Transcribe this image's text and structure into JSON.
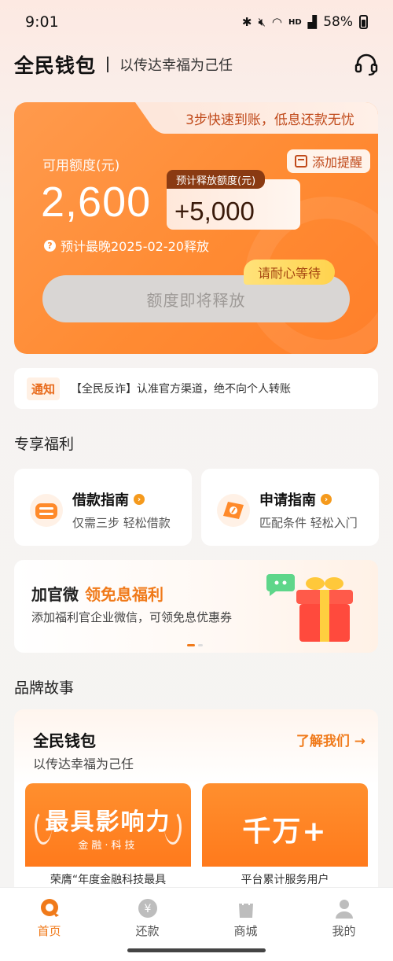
{
  "status_bar": {
    "time": "9:01",
    "network": "HD",
    "battery": "58%"
  },
  "header": {
    "brand": "全民钱包",
    "slogan": "以传达幸福为己任"
  },
  "hero": {
    "tab_text": "3步快速到账，低息还款无忧",
    "available_label": "可用额度(元)",
    "available_amount": "2,600",
    "remind_label": "添加提醒",
    "release_tag": "预计释放额度(元)",
    "release_amount": "+5,000",
    "eta_text": "预计最晚2025-02-20释放",
    "wait_tag": "请耐心等待",
    "release_button": "额度即将释放"
  },
  "notice": {
    "tag": "通知",
    "text": "【全民反诈】认准官方渠道，绝不向个人转账"
  },
  "benefits": {
    "title": "专享福利",
    "cards": [
      {
        "title": "借款指南",
        "subtitle": "仅需三步 轻松借款"
      },
      {
        "title": "申请指南",
        "subtitle": "匹配条件 轻松入门"
      }
    ],
    "banner": {
      "title": "加官微",
      "highlight": "领免息福利",
      "subtitle": "添加福利官企业微信，可领免息优惠券"
    }
  },
  "brand_story": {
    "section_title": "品牌故事",
    "title": "全民钱包",
    "subtitle": "以传达幸福为己任",
    "link": "了解我们 →",
    "tiles": [
      {
        "big": "最具影响力",
        "small": "金融·科技",
        "caption": "荣膺“年度金融科技最具"
      },
      {
        "big": "千万+",
        "caption": "平台累计服务用户"
      }
    ]
  },
  "tabbar": {
    "items": [
      {
        "label": "首页",
        "active": true
      },
      {
        "label": "还款",
        "active": false
      },
      {
        "label": "商城",
        "active": false
      },
      {
        "label": "我的",
        "active": false
      }
    ]
  },
  "colors": {
    "accent": "#f07a1a",
    "hero": "#ff8b33"
  }
}
